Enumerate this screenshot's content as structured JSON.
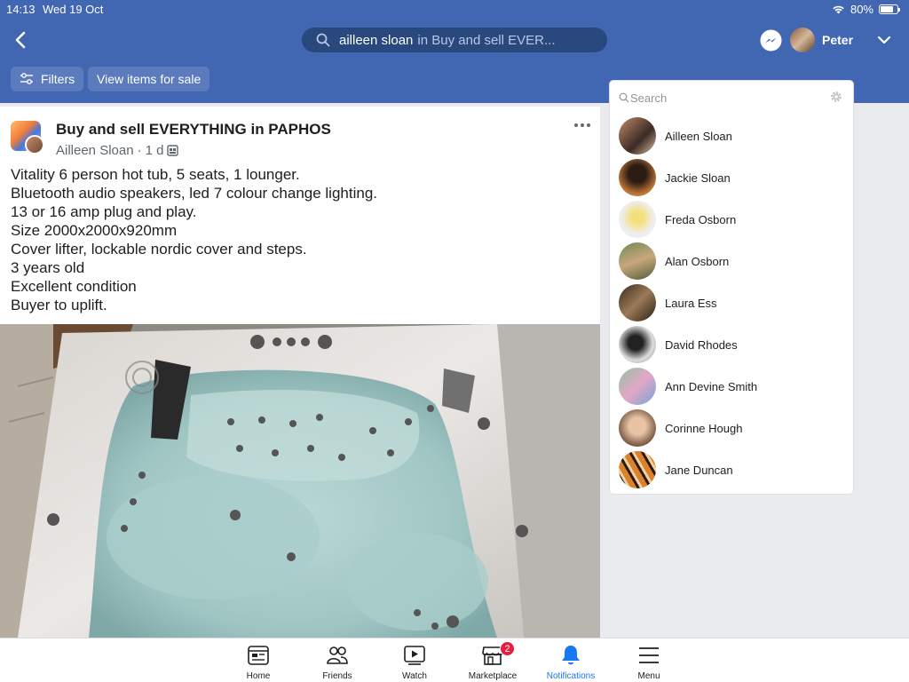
{
  "status_bar": {
    "time": "14:13",
    "date": "Wed 19 Oct",
    "battery_text": "80%",
    "battery_level": 0.8
  },
  "header": {
    "search_query": "ailleen sloan",
    "search_context": "in Buy and sell EVER...",
    "profile_name": "Peter",
    "brand_color": "#4267b2"
  },
  "subbar": {
    "filters_label": "Filters",
    "view_items_label": "View items for sale"
  },
  "post": {
    "group_name": "Buy and sell EVERYTHING in PAPHOS",
    "author": "Ailleen Sloan",
    "separator": "·",
    "time": "1 d",
    "lines": [
      "Vitality 6 person hot tub, 5 seats, 1 lounger.",
      "Bluetooth audio speakers, led 7 colour change lighting.",
      "13 or 16 amp plug and play.",
      "Size 2000x2000x920mm",
      "Cover lifter, lockable nordic cover and steps.",
      "3 years old",
      "Excellent condition",
      "Buyer to uplift."
    ]
  },
  "sidebar": {
    "search_placeholder": "Search",
    "friends": [
      {
        "name": "Ailleen Sloan"
      },
      {
        "name": "Jackie Sloan"
      },
      {
        "name": "Freda Osborn"
      },
      {
        "name": "Alan Osborn"
      },
      {
        "name": "Laura Ess"
      },
      {
        "name": "David Rhodes"
      },
      {
        "name": "Ann Devine Smith"
      },
      {
        "name": "Corinne Hough"
      },
      {
        "name": "Jane Duncan"
      }
    ]
  },
  "tabbar": {
    "tabs": [
      {
        "label": "Home",
        "icon": "home-icon"
      },
      {
        "label": "Friends",
        "icon": "friends-icon"
      },
      {
        "label": "Watch",
        "icon": "watch-icon"
      },
      {
        "label": "Marketplace",
        "icon": "marketplace-icon",
        "badge": "2"
      },
      {
        "label": "Notifications",
        "icon": "bell-icon",
        "active": true
      },
      {
        "label": "Menu",
        "icon": "menu-icon"
      }
    ],
    "active_color": "#1877f2"
  }
}
